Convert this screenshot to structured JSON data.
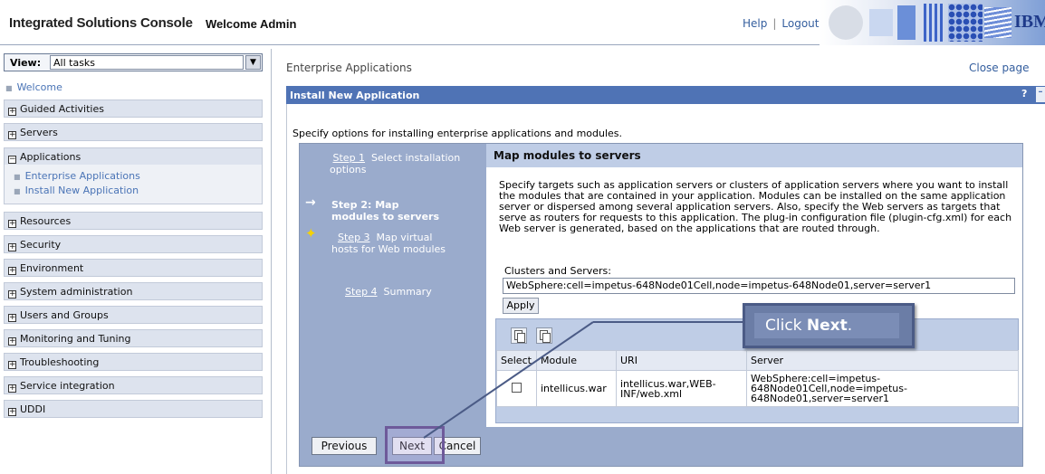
{
  "banner": {
    "app_title": "Integrated Solutions Console",
    "welcome": "Welcome Admin",
    "help": "Help",
    "separator": "|",
    "logout": "Logout",
    "logo": "IBM"
  },
  "nav": {
    "view_label": "View:",
    "view_value": "All tasks",
    "welcome": "Welcome",
    "categories": {
      "guided": "Guided Activities",
      "servers": "Servers",
      "applications": "Applications",
      "resources": "Resources",
      "security": "Security",
      "environment": "Environment",
      "sysadmin": "System administration",
      "users": "Users and Groups",
      "monitoring": "Monitoring and Tuning",
      "troubleshooting": "Troubleshooting",
      "service": "Service integration",
      "uddi": "UDDI"
    },
    "app_items": [
      "Enterprise Applications",
      "Install New Application"
    ]
  },
  "main": {
    "page_title": "Enterprise Applications",
    "close_page": "Close page",
    "portlet_title": "Install New Application",
    "help": "?",
    "intro": "Specify options for installing enterprise applications and modules."
  },
  "wizard": {
    "step1_link": "Step 1",
    "step1_text": "Select installation options",
    "step2_text": "Step 2: Map modules to servers",
    "step3_link": "Step 3",
    "step3_text": "Map virtual hosts for Web modules",
    "step4_link": "Step 4",
    "step4_text": "Summary",
    "section_title": "Map modules to servers",
    "description": "Specify targets such as application servers or clusters of application servers where you want to install the modules that are contained in your application. Modules can be installed on the same application server or dispersed among several application servers. Also, specify the Web servers as targets that serve as routers for requests to this application. The plug-in configuration file (plugin-cfg.xml) for each Web server is generated, based on the applications that are routed through.",
    "clusters_label": "Clusters and Servers:",
    "clusters_value": "WebSphere:cell=impetus-648Node01Cell,node=impetus-648Node01,server=server1",
    "apply": "Apply",
    "table": {
      "headers": [
        "Select",
        "Module",
        "URI",
        "Server"
      ],
      "row": {
        "module": "intellicus.war",
        "uri": "intellicus.war,WEB-INF/web.xml",
        "server": "WebSphere:cell=impetus-648Node01Cell,node=impetus-648Node01,server=server1"
      }
    },
    "buttons": {
      "previous": "Previous",
      "next": "Next",
      "cancel": "Cancel"
    }
  },
  "callout": {
    "prefix": "Click ",
    "bold": "Next",
    "suffix": "."
  },
  "colors": {
    "portlet_bar": "#4f73b5",
    "wizard_bg": "#9aabcc",
    "section_header": "#bfcde6",
    "callout": "#6b7da6"
  }
}
